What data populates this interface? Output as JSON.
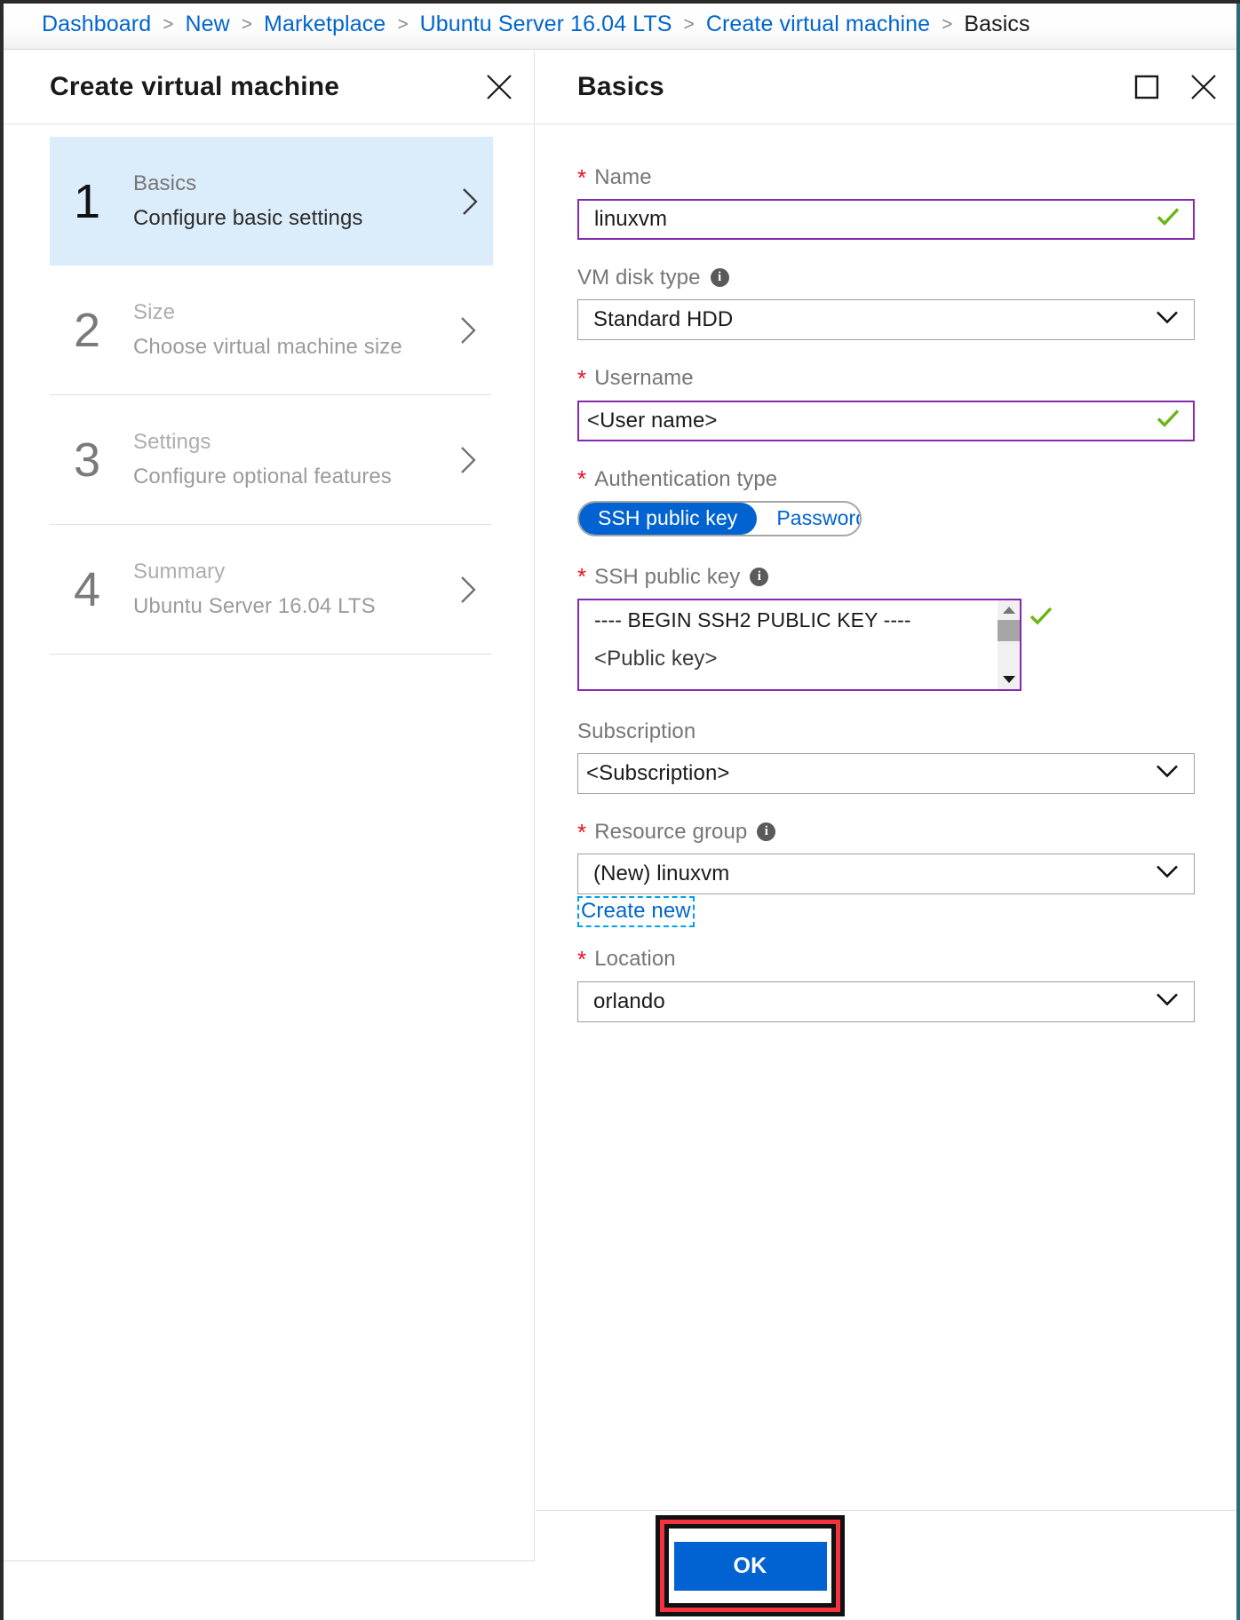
{
  "breadcrumb": {
    "items": [
      {
        "label": "Dashboard",
        "current": false
      },
      {
        "label": "New",
        "current": false
      },
      {
        "label": "Marketplace",
        "current": false
      },
      {
        "label": "Ubuntu Server 16.04 LTS",
        "current": false
      },
      {
        "label": "Create virtual machine",
        "current": false
      },
      {
        "label": "Basics",
        "current": true
      }
    ],
    "separator": ">",
    "link_color": "#0066cc",
    "current_color": "#1a1a1a"
  },
  "left_blade": {
    "title": "Create virtual machine",
    "close_icon": "close-icon",
    "steps": [
      {
        "num": "1",
        "title": "Basics",
        "desc": "Configure basic settings",
        "active": true
      },
      {
        "num": "2",
        "title": "Size",
        "desc": "Choose virtual machine size",
        "active": false
      },
      {
        "num": "3",
        "title": "Settings",
        "desc": "Configure optional features",
        "active": false
      },
      {
        "num": "4",
        "title": "Summary",
        "desc": "Ubuntu Server 16.04 LTS",
        "active": false
      }
    ],
    "active_bg": "#dbecfb",
    "chevron_icon": "chevron-right-icon"
  },
  "right_blade": {
    "title": "Basics",
    "maximize_icon": "maximize-icon",
    "close_icon": "close-icon",
    "fields": {
      "name": {
        "label": "Name",
        "required": true,
        "value": "linuxvm",
        "valid": true,
        "border_color": "#8529ad",
        "check_color": "#6cb513"
      },
      "vm_disk_type": {
        "label": "VM disk type",
        "required": false,
        "info": true,
        "value": "Standard HDD"
      },
      "username": {
        "label": "Username",
        "required": true,
        "value": "<User name>",
        "valid": true
      },
      "auth_type": {
        "label": "Authentication type",
        "required": true,
        "options": [
          "SSH public key",
          "Password"
        ],
        "selected": "SSH public key",
        "selected_bg": "#0063d1",
        "unselected_color": "#0063d1"
      },
      "ssh_public_key": {
        "label": "SSH public key",
        "required": true,
        "info": true,
        "line1": "---- BEGIN SSH2 PUBLIC KEY ----",
        "line2": "<Public key>",
        "valid": true,
        "scrollbar": {
          "up_icon": "scroll-up-arrow-icon",
          "down_icon": "scroll-down-arrow-icon"
        }
      },
      "subscription": {
        "label": "Subscription",
        "required": false,
        "value": "<Subscription>"
      },
      "resource_group": {
        "label": "Resource group",
        "required": true,
        "info": true,
        "value": "(New) linuxvm",
        "create_new_link": "Create new"
      },
      "location": {
        "label": "Location",
        "required": true,
        "value": "orlando"
      }
    },
    "required_marker": "*",
    "required_color": "#e81123",
    "caret_icon": "chevron-down-icon",
    "info_icon": "info-icon"
  },
  "footer": {
    "ok_label": "OK",
    "ok_bg": "#0063d1",
    "annotation_color": "#f4333e"
  }
}
